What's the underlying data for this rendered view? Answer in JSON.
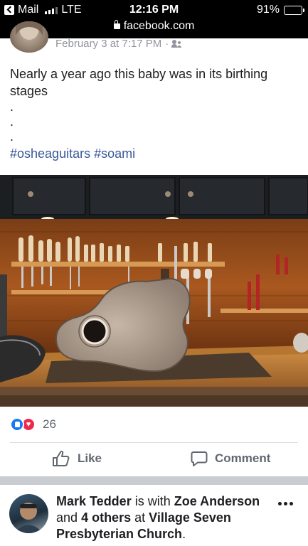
{
  "status_bar": {
    "back_app": "Mail",
    "carrier": "LTE",
    "time": "12:16 PM",
    "battery": "91%",
    "battery_level": 0.91
  },
  "url_bar": {
    "domain": "facebook.com"
  },
  "post": {
    "timestamp": "February 3 at 7:17 PM",
    "separator": "·",
    "audience_icon": "friends-icon",
    "text": "Nearly a year ago this baby was in its birthing stages",
    "dots": [
      ".",
      ".",
      "."
    ],
    "hashtags": [
      "#osheaguitars",
      "#soami"
    ],
    "reaction_count": "26",
    "actions": {
      "like": "Like",
      "comment": "Comment"
    }
  },
  "next_story": {
    "author": "Mark Tedder",
    "is_with": "is with",
    "tagged": "Zoe Anderson",
    "and_text": "and",
    "others": "4 others",
    "at_text": "at",
    "place": "Village Seven Presbyterian Church",
    "period": "."
  },
  "colors": {
    "link": "#385898",
    "meta_gray": "#90949c",
    "action_gray": "#606770",
    "like_blue": "#1877f2",
    "love_red": "#f0284a"
  }
}
